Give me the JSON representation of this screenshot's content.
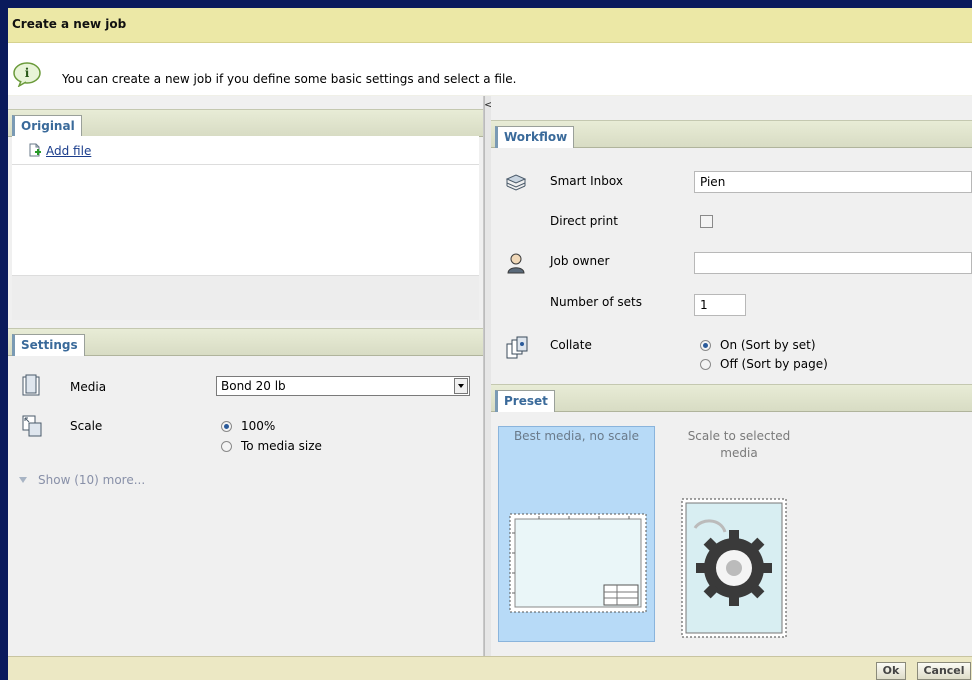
{
  "dialog": {
    "title": "Create a new job",
    "info_text": "You can create a new job if you define some basic settings and select a file."
  },
  "original": {
    "tab_label": "Original",
    "add_file_label": "Add file"
  },
  "settings": {
    "tab_label": "Settings",
    "media_label": "Media",
    "media_value": "Bond 20 lb",
    "scale_label": "Scale",
    "scale_options": [
      "100%",
      "To media size"
    ],
    "scale_selected": "100%",
    "show_more_label": "Show (10) more..."
  },
  "splitter": {
    "collapse_glyph": "<"
  },
  "workflow": {
    "tab_label": "Workflow",
    "smart_inbox_label": "Smart Inbox",
    "smart_inbox_value": "Pien",
    "direct_print_label": "Direct print",
    "direct_print_checked": false,
    "job_owner_label": "Job owner",
    "job_owner_value": "",
    "number_of_sets_label": "Number of sets",
    "number_of_sets_value": "1",
    "collate_label": "Collate",
    "collate_options": [
      "On (Sort by set)",
      "Off (Sort by page)"
    ],
    "collate_selected": "On (Sort by set)"
  },
  "preset": {
    "tab_label": "Preset",
    "items": [
      {
        "name": "Best media, no scale",
        "selected": true,
        "icon": "blueprint-icon"
      },
      {
        "name": "Scale to selected media",
        "selected": false,
        "icon": "gear-scale-icon"
      }
    ]
  },
  "buttons": {
    "ok_label": "Ok",
    "cancel_label": "Cancel"
  },
  "colors": {
    "title_bg": "#ece8a6",
    "accent": "#3a6a9a",
    "selected_preset_bg": "#b7daf7",
    "frame_border": "#0a1a5c"
  }
}
